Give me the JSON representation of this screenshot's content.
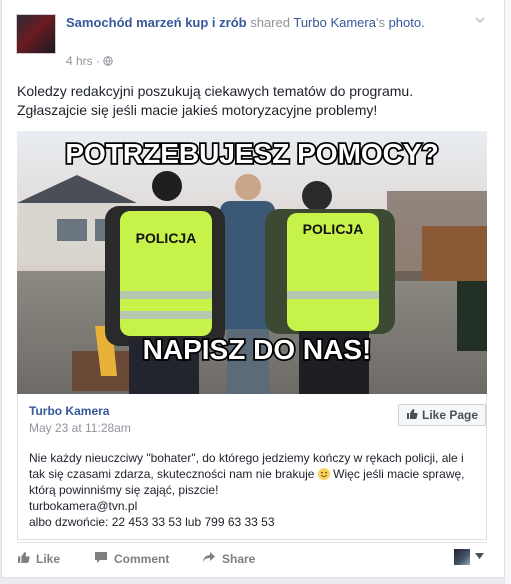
{
  "post": {
    "author": "Samochód marzeń kup i zrób",
    "action_text": "shared",
    "shared_from": "Turbo Kamera",
    "shared_suffix": "'s",
    "object": "photo.",
    "time": "4 hrs",
    "separator": "·",
    "text_lines": [
      "Koledzy redakcyjni poszukują ciekawych tematów do programu.",
      "Zgłaszajcie się jeśli macie jakieś motoryzacyjne problemy!"
    ]
  },
  "photo": {
    "top_caption": "POTRZEBUJESZ  POMOCY?",
    "bottom_caption": "NAPISZ DO NAS!",
    "vest_label": "POLICJA"
  },
  "shared": {
    "page_name": "Turbo Kamera",
    "date": "May 23 at 11:28am",
    "like_page_label": "Like Page",
    "body_lines": [
      "Nie każdy nieuczciwy \"bohater\", do którego jedziemy kończy w rękach policji, ale i",
      "tak się czasami zdarza, skuteczności nam nie brakuje",
      " Więc jeśli macie sprawę,",
      "którą powinniśmy się zająć, piszcie!",
      "turbokamera@tvn.pl",
      "albo dzwońcie: 22 453 33 53 lub 799 63 33 53"
    ]
  },
  "actions": {
    "like": "Like",
    "comment": "Comment",
    "share": "Share"
  },
  "colors": {
    "link": "#365899",
    "muted": "#90949c",
    "vest": "#c6f24a"
  }
}
